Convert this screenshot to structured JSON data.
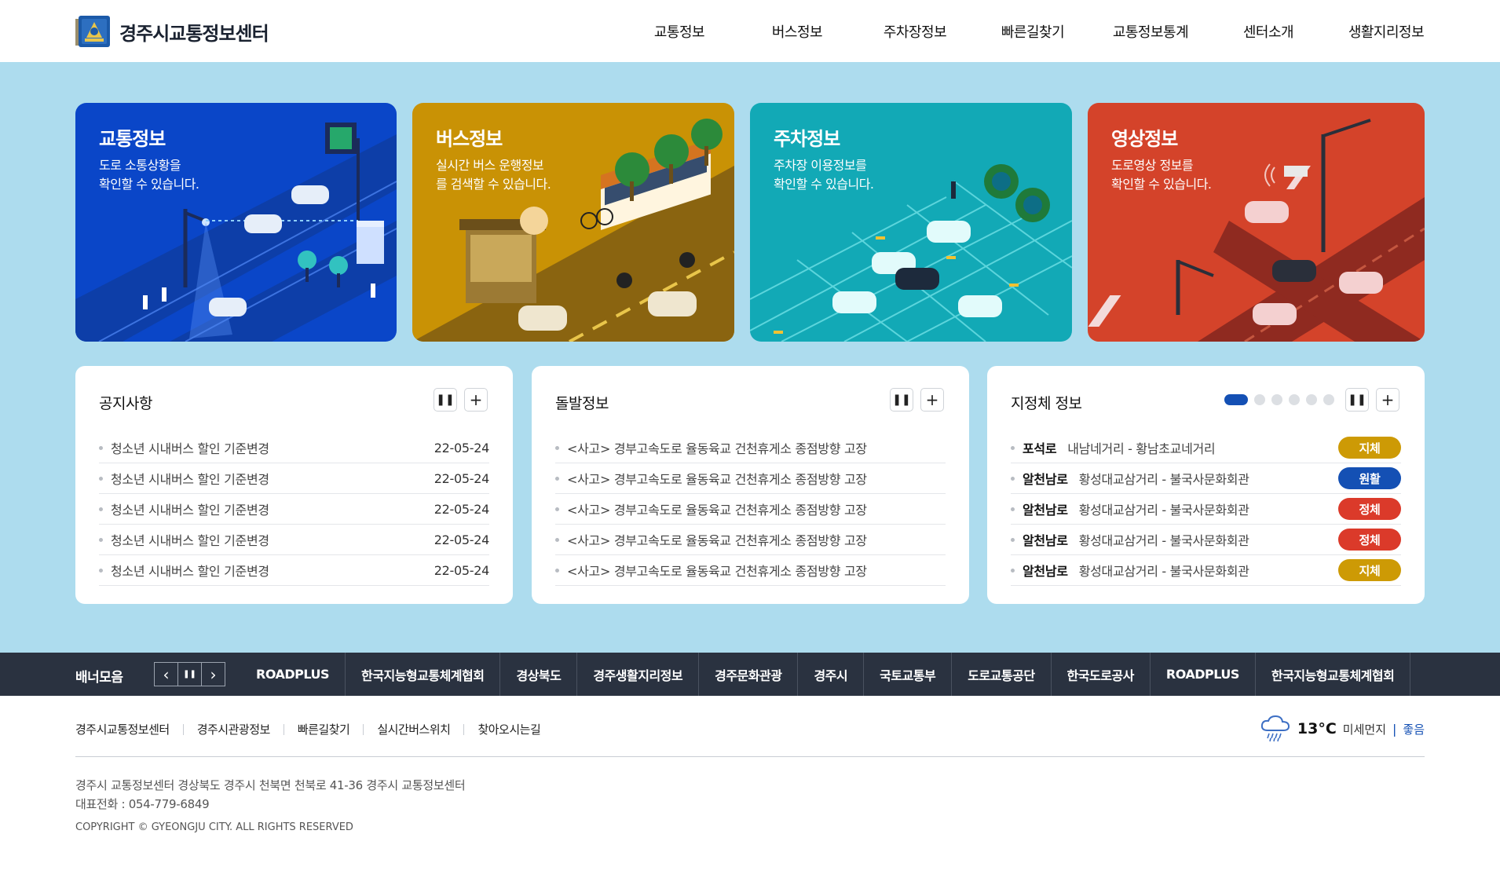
{
  "header": {
    "logo_text": "경주시교통정보센터",
    "nav": [
      "교통정보",
      "버스정보",
      "주차장정보",
      "빠른길찾기",
      "교통정보통계",
      "센터소개",
      "생활지리정보"
    ]
  },
  "cards": [
    {
      "title": "교통정보",
      "desc": "도로 소통상황을\n확인할 수 있습니다.",
      "color": "#0a46c8"
    },
    {
      "title": "버스정보",
      "desc": "실시간 버스 운행정보\n를 검색할 수 있습니다.",
      "color": "#c99205"
    },
    {
      "title": "주차정보",
      "desc": "주차장 이용정보를\n확인할 수 있습니다.",
      "color": "#12a9b6"
    },
    {
      "title": "영상정보",
      "desc": "도로영상 정보를\n확인할 수 있습니다.",
      "color": "#d4432a"
    }
  ],
  "notice": {
    "title": "공지사항",
    "items": [
      {
        "text": "청소년 시내버스 할인 기준변경",
        "date": "22-05-24"
      },
      {
        "text": "청소년 시내버스 할인 기준변경",
        "date": "22-05-24"
      },
      {
        "text": "청소년 시내버스 할인 기준변경",
        "date": "22-05-24"
      },
      {
        "text": "청소년 시내버스 할인 기준변경",
        "date": "22-05-24"
      },
      {
        "text": "청소년 시내버스 할인 기준변경",
        "date": "22-05-24"
      }
    ]
  },
  "incident": {
    "title": "돌발정보",
    "items": [
      "<사고> 경부고속도로 율동육교 건천휴게소 종점방향 고장",
      "<사고> 경부고속도로 율동육교 건천휴게소 종점방향 고장",
      "<사고> 경부고속도로 율동육교 건천휴게소 종점방향 고장",
      "<사고> 경부고속도로 율동육교 건천휴게소 종점방향 고장",
      "<사고> 경부고속도로 율동육교 건천휴게소 종점방향 고장"
    ]
  },
  "congestion": {
    "title": "지정체 정보",
    "pager_count": 6,
    "pager_active": 1,
    "items": [
      {
        "road": "포석로",
        "section": "내남네거리 - 황남초교네거리",
        "status": "지체",
        "color": "#cd9a05"
      },
      {
        "road": "알천남로",
        "section": "황성대교삼거리 - 불국사문화회관",
        "status": "원활",
        "color": "#1450b4"
      },
      {
        "road": "알천남로",
        "section": "황성대교삼거리 - 불국사문화회관",
        "status": "정체",
        "color": "#db3a2a"
      },
      {
        "road": "알천남로",
        "section": "황성대교삼거리 - 불국사문화회관",
        "status": "정체",
        "color": "#db3a2a"
      },
      {
        "road": "알천남로",
        "section": "황성대교삼거리 - 불국사문화회관",
        "status": "지체",
        "color": "#cd9a05"
      }
    ]
  },
  "panel_controls": {
    "pause": "❚❚",
    "more": "+"
  },
  "banner": {
    "title": "배너모음",
    "prev": "‹",
    "pause": "❚❚",
    "next": "›",
    "links": [
      "ROADPLUS",
      "한국지능형교통체계협회",
      "경상북도",
      "경주생활지리정보",
      "경주문화관광",
      "경주시",
      "국토교통부",
      "도로교통공단",
      "한국도로공사",
      "ROADPLUS",
      "한국지능형교통체계협회"
    ]
  },
  "footer": {
    "links": [
      "경주시교통정보센터",
      "경주시관광정보",
      "빠른길찾기",
      "실시간버스위치",
      "찾아오시는길"
    ],
    "weather": {
      "temp": "13°C",
      "dust_label": "미세먼지",
      "dust_grade": "좋음",
      "icon": "rain-cloud-icon"
    },
    "address": "경주시 교통정보센터 경상북도 경주시 천북면 천북로 41-36 경주시 교통정보센터",
    "phone": "대표전화 : 054-779-6849",
    "copyright": "COPYRIGHT © GYEONGJU CITY. ALL RIGHTS RESERVED"
  }
}
